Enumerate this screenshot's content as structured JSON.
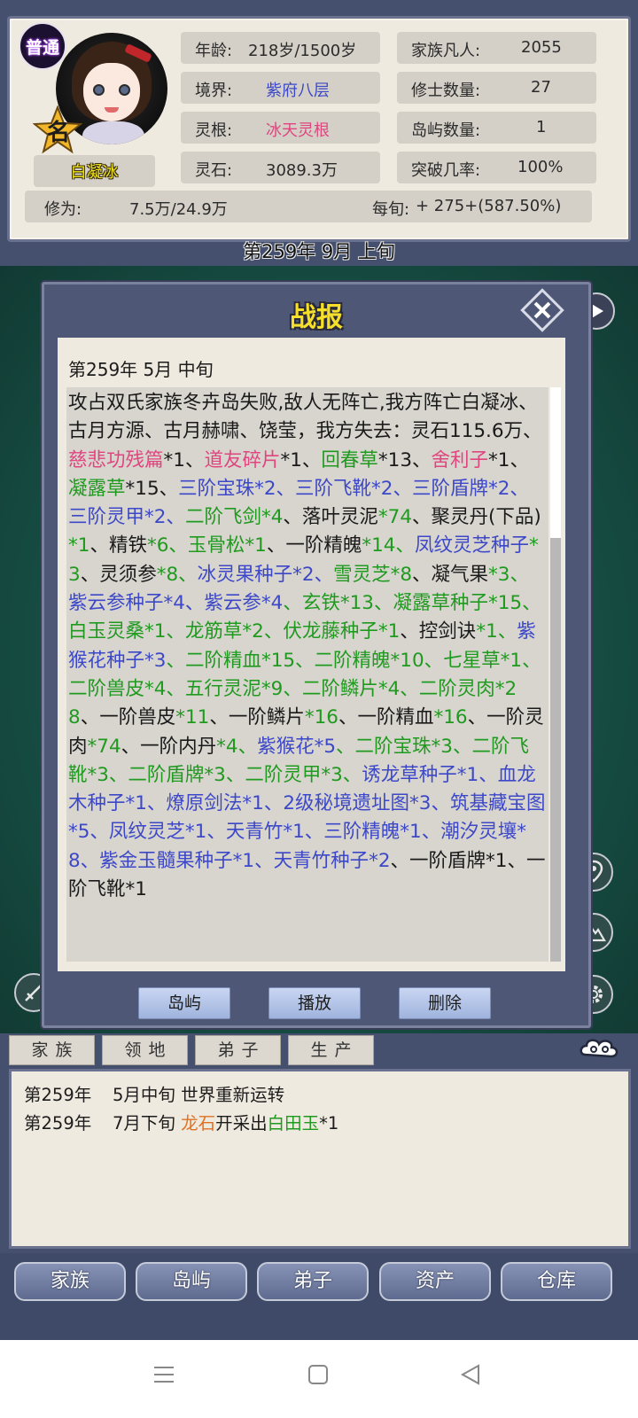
{
  "character": {
    "rank_badge": "普通",
    "star_label": "名",
    "name": "白凝冰"
  },
  "stats": {
    "age": {
      "label": "年龄:",
      "value": "218岁/1500岁"
    },
    "realm": {
      "label": "境界:",
      "value": "紫府八层",
      "color": "#3c48c8"
    },
    "root": {
      "label": "灵根:",
      "value": "冰天灵根",
      "color": "#e0457f"
    },
    "stones": {
      "label": "灵石:",
      "value": "3089.3万"
    },
    "family": {
      "label": "家族凡人:",
      "value": "2055"
    },
    "cultivators": {
      "label": "修士数量:",
      "value": "27"
    },
    "islands": {
      "label": "岛屿数量:",
      "value": "1"
    },
    "breakthrough": {
      "label": "突破几率:",
      "value": "100%"
    },
    "xiuwei": {
      "label": "修为:",
      "value": "7.5万/24.9万"
    },
    "per_period": {
      "label": "每旬:",
      "value": "+ 275+(587.50%)"
    }
  },
  "current_date": "第259年 9月 上旬",
  "report": {
    "title": "战报",
    "date": "第259年 5月 中旬",
    "segments": [
      {
        "text": "攻占双氏家族冬卉岛失败,敌人无阵亡,我方阵亡白凝冰、古月方源、古月赫啸、饶莹，我方失去：灵石115.6万、",
        "c": ""
      },
      {
        "text": "慈悲功残篇",
        "c": "pink"
      },
      {
        "text": "*1、",
        "c": ""
      },
      {
        "text": "道友碎片",
        "c": "pink"
      },
      {
        "text": "*1、",
        "c": ""
      },
      {
        "text": "回春草",
        "c": "green"
      },
      {
        "text": "*13、",
        "c": ""
      },
      {
        "text": "舍利子",
        "c": "pink"
      },
      {
        "text": "*1、",
        "c": ""
      },
      {
        "text": "凝露草",
        "c": "green"
      },
      {
        "text": "*15、",
        "c": ""
      },
      {
        "text": "三阶宝珠*2、三阶飞靴*2、三阶盾牌*2、三阶灵甲*2、",
        "c": "blue"
      },
      {
        "text": "二阶飞剑*4",
        "c": "green"
      },
      {
        "text": "、落叶灵泥",
        "c": ""
      },
      {
        "text": "*74",
        "c": "green"
      },
      {
        "text": "、聚灵丹(下品)",
        "c": ""
      },
      {
        "text": "*1",
        "c": "green"
      },
      {
        "text": "、精铁",
        "c": ""
      },
      {
        "text": "*6、玉骨松*1",
        "c": "green"
      },
      {
        "text": "、一阶精魄",
        "c": ""
      },
      {
        "text": "*14、",
        "c": "green"
      },
      {
        "text": "凤纹灵芝种子",
        "c": "blue"
      },
      {
        "text": "*3",
        "c": "green"
      },
      {
        "text": "、灵须参",
        "c": ""
      },
      {
        "text": "*8、",
        "c": "green"
      },
      {
        "text": "冰灵果种子*2、",
        "c": "blue"
      },
      {
        "text": "雪灵芝*8",
        "c": "green"
      },
      {
        "text": "、凝气果",
        "c": ""
      },
      {
        "text": "*3、",
        "c": "green"
      },
      {
        "text": "紫云参种子*4、紫云参*4",
        "c": "blue"
      },
      {
        "text": "、玄铁*13、凝露草种子*15、白玉灵桑*1、龙筋草*2、伏龙藤种子*1",
        "c": "green"
      },
      {
        "text": "、控剑诀",
        "c": ""
      },
      {
        "text": "*1、",
        "c": "green"
      },
      {
        "text": "紫猴花种子*3",
        "c": "blue"
      },
      {
        "text": "、二阶精血*15、二阶精魄*10、七星草*1、二阶兽皮*4、五行灵泥*9、二阶鳞片*4、二阶灵肉*28",
        "c": "green"
      },
      {
        "text": "、一阶兽皮",
        "c": ""
      },
      {
        "text": "*11",
        "c": "green"
      },
      {
        "text": "、一阶鳞片",
        "c": ""
      },
      {
        "text": "*16",
        "c": "green"
      },
      {
        "text": "、一阶精血",
        "c": ""
      },
      {
        "text": "*16",
        "c": "green"
      },
      {
        "text": "、一阶灵肉",
        "c": ""
      },
      {
        "text": "*74",
        "c": "green"
      },
      {
        "text": "、一阶内丹",
        "c": ""
      },
      {
        "text": "*4、",
        "c": "green"
      },
      {
        "text": "紫猴花*5",
        "c": "blue"
      },
      {
        "text": "、二阶宝珠*3、二阶飞靴*3、二阶盾牌*3、二阶灵甲*3、",
        "c": "green"
      },
      {
        "text": "诱龙草种子*1、血龙木种子*1、燎原剑法*1、2级秘境遗址图*3、筑基藏宝图*5、凤纹灵芝*1、天青竹*1、三阶精魄*1、潮汐灵壤*8、紫金玉髓果种子*1、天青竹种子*2",
        "c": "blue"
      },
      {
        "text": "、一阶盾牌*1、一阶飞靴*1",
        "c": ""
      }
    ],
    "buttons": [
      "岛屿",
      "播放",
      "删除"
    ]
  },
  "tabs": [
    "家族",
    "领地",
    "弟子",
    "生产"
  ],
  "log": [
    {
      "year": "第259年",
      "parts": [
        {
          "t": "5月中旬 世界重新运转",
          "c": ""
        }
      ]
    },
    {
      "year": "第259年",
      "parts": [
        {
          "t": "7月下旬 ",
          "c": ""
        },
        {
          "t": "龙石",
          "c": "orange"
        },
        {
          "t": "开采出",
          "c": ""
        },
        {
          "t": "白田玉",
          "c": "green"
        },
        {
          "t": "*1",
          "c": ""
        }
      ]
    }
  ],
  "nav": [
    "家族",
    "岛屿",
    "弟子",
    "资产",
    "仓库"
  ],
  "icons": {
    "close": "close-x-icon",
    "play": "play-icon",
    "map": "map-pin-icon",
    "mountain": "mountain-icon",
    "settings": "gear-icon",
    "cloud": "cloud-icon",
    "menu": "menu-icon",
    "home": "home-icon",
    "back": "back-icon"
  },
  "colors": {
    "pink": "#e0457f",
    "green": "#1f9a1f",
    "blue": "#3c48c8",
    "orange": "#e07020",
    "title_gold": "#f5df2a"
  }
}
